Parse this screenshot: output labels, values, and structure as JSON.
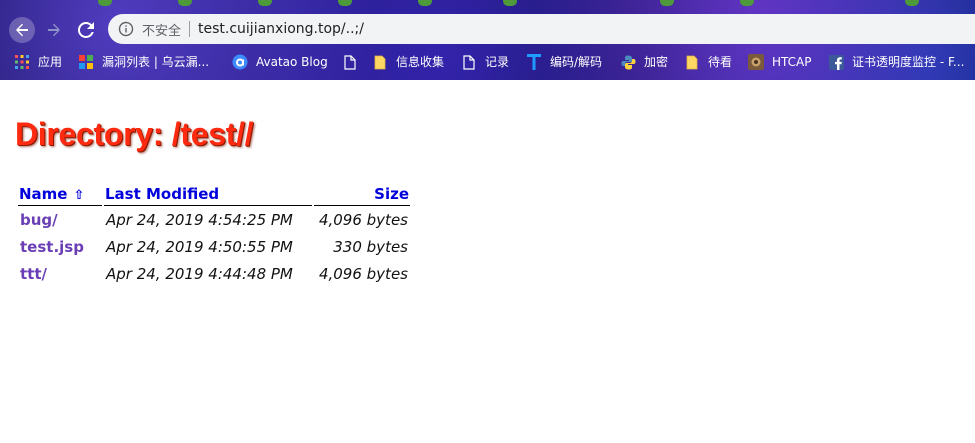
{
  "browser": {
    "url": "test.cuijianxiong.top/..;/",
    "security_label": "不安全",
    "bookmarks": [
      {
        "label": "应用",
        "icon": "apps-grid-icon"
      },
      {
        "label": "漏洞列表 | 乌云漏...",
        "icon": "wooyun-icon"
      },
      {
        "label": "Avatao Blog",
        "icon": "avatao-icon"
      },
      {
        "label": "",
        "icon": "page-icon"
      },
      {
        "label": "信息收集",
        "icon": "folder-icon"
      },
      {
        "label": "记录",
        "icon": "page-icon"
      },
      {
        "label": "编码/解码",
        "icon": "t-letter-icon"
      },
      {
        "label": "加密",
        "icon": "python-icon"
      },
      {
        "label": "待看",
        "icon": "folder-icon"
      },
      {
        "label": "HTCAP",
        "icon": "htcap-icon"
      },
      {
        "label": "证书透明度监控 - F...",
        "icon": "facebook-icon"
      }
    ]
  },
  "page": {
    "title": "Directory: /test//",
    "columns": {
      "name": "Name",
      "sort_arrow": "⇧",
      "modified": "Last Modified",
      "size": "Size"
    },
    "rows": [
      {
        "name": "bug/",
        "modified": "Apr 24, 2019 4:54:25 PM",
        "size": "4,096 bytes"
      },
      {
        "name": "test.jsp",
        "modified": "Apr 24, 2019 4:50:55 PM",
        "size": "330 bytes"
      },
      {
        "name": "ttt/",
        "modified": "Apr 24, 2019 4:44:48 PM",
        "size": "4,096 bytes"
      }
    ]
  },
  "colors": {
    "title": "#ff2a0f",
    "header_link": "#0000dd",
    "visited_link": "#6a3fb5"
  }
}
